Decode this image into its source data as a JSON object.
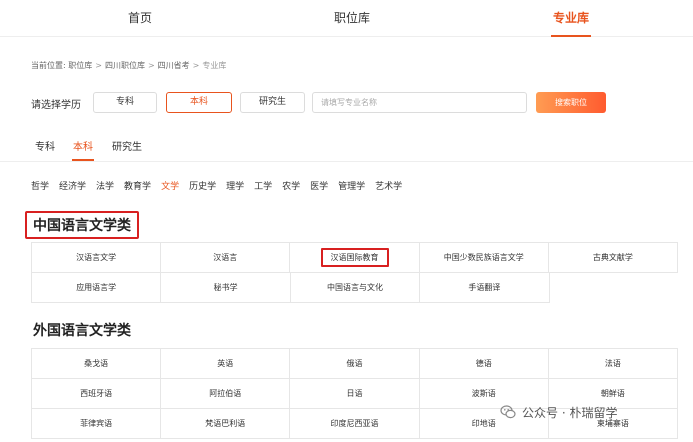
{
  "nav": {
    "items": [
      {
        "label": "首页",
        "active": false
      },
      {
        "label": "职位库",
        "active": false
      },
      {
        "label": "专业库",
        "active": true
      }
    ]
  },
  "breadcrumb": {
    "items": [
      "当前位置: 职位库",
      "四川职位库",
      "四川省考",
      "专业库"
    ]
  },
  "education": {
    "label": "请选择学历",
    "options": [
      {
        "label": "专科",
        "active": false
      },
      {
        "label": "本科",
        "active": true
      },
      {
        "label": "研究生",
        "active": false
      }
    ],
    "search_placeholder": "请填写专业名称",
    "search_button": "搜索职位"
  },
  "level_tabs": [
    {
      "label": "专科",
      "active": false
    },
    {
      "label": "本科",
      "active": true
    },
    {
      "label": "研究生",
      "active": false
    }
  ],
  "disciplines": [
    {
      "label": "哲学",
      "active": false
    },
    {
      "label": "经济学",
      "active": false
    },
    {
      "label": "法学",
      "active": false
    },
    {
      "label": "教育学",
      "active": false
    },
    {
      "label": "文学",
      "active": true
    },
    {
      "label": "历史学",
      "active": false
    },
    {
      "label": "理学",
      "active": false
    },
    {
      "label": "工学",
      "active": false
    },
    {
      "label": "农学",
      "active": false
    },
    {
      "label": "医学",
      "active": false
    },
    {
      "label": "管理学",
      "active": false
    },
    {
      "label": "艺术学",
      "active": false
    }
  ],
  "sections": [
    {
      "title": "中国语言文学类",
      "majors": [
        "汉语言文学",
        "汉语言",
        "汉语国际教育",
        "中国少数民族语言文学",
        "古典文献学",
        "应用语言学",
        "秘书学",
        "中国语言与文化",
        "手语翻译"
      ]
    },
    {
      "title": "外国语言文学类",
      "majors": [
        "桑戈语",
        "英语",
        "俄语",
        "德语",
        "法语",
        "西班牙语",
        "阿拉伯语",
        "日语",
        "波斯语",
        "朝鲜语",
        "菲律宾语",
        "梵语巴利语",
        "印度尼西亚语",
        "印地语",
        "柬埔寨语"
      ]
    }
  ],
  "watermark": {
    "text": "公众号 · 朴瑞留学",
    "icon": "wechat-icon"
  }
}
